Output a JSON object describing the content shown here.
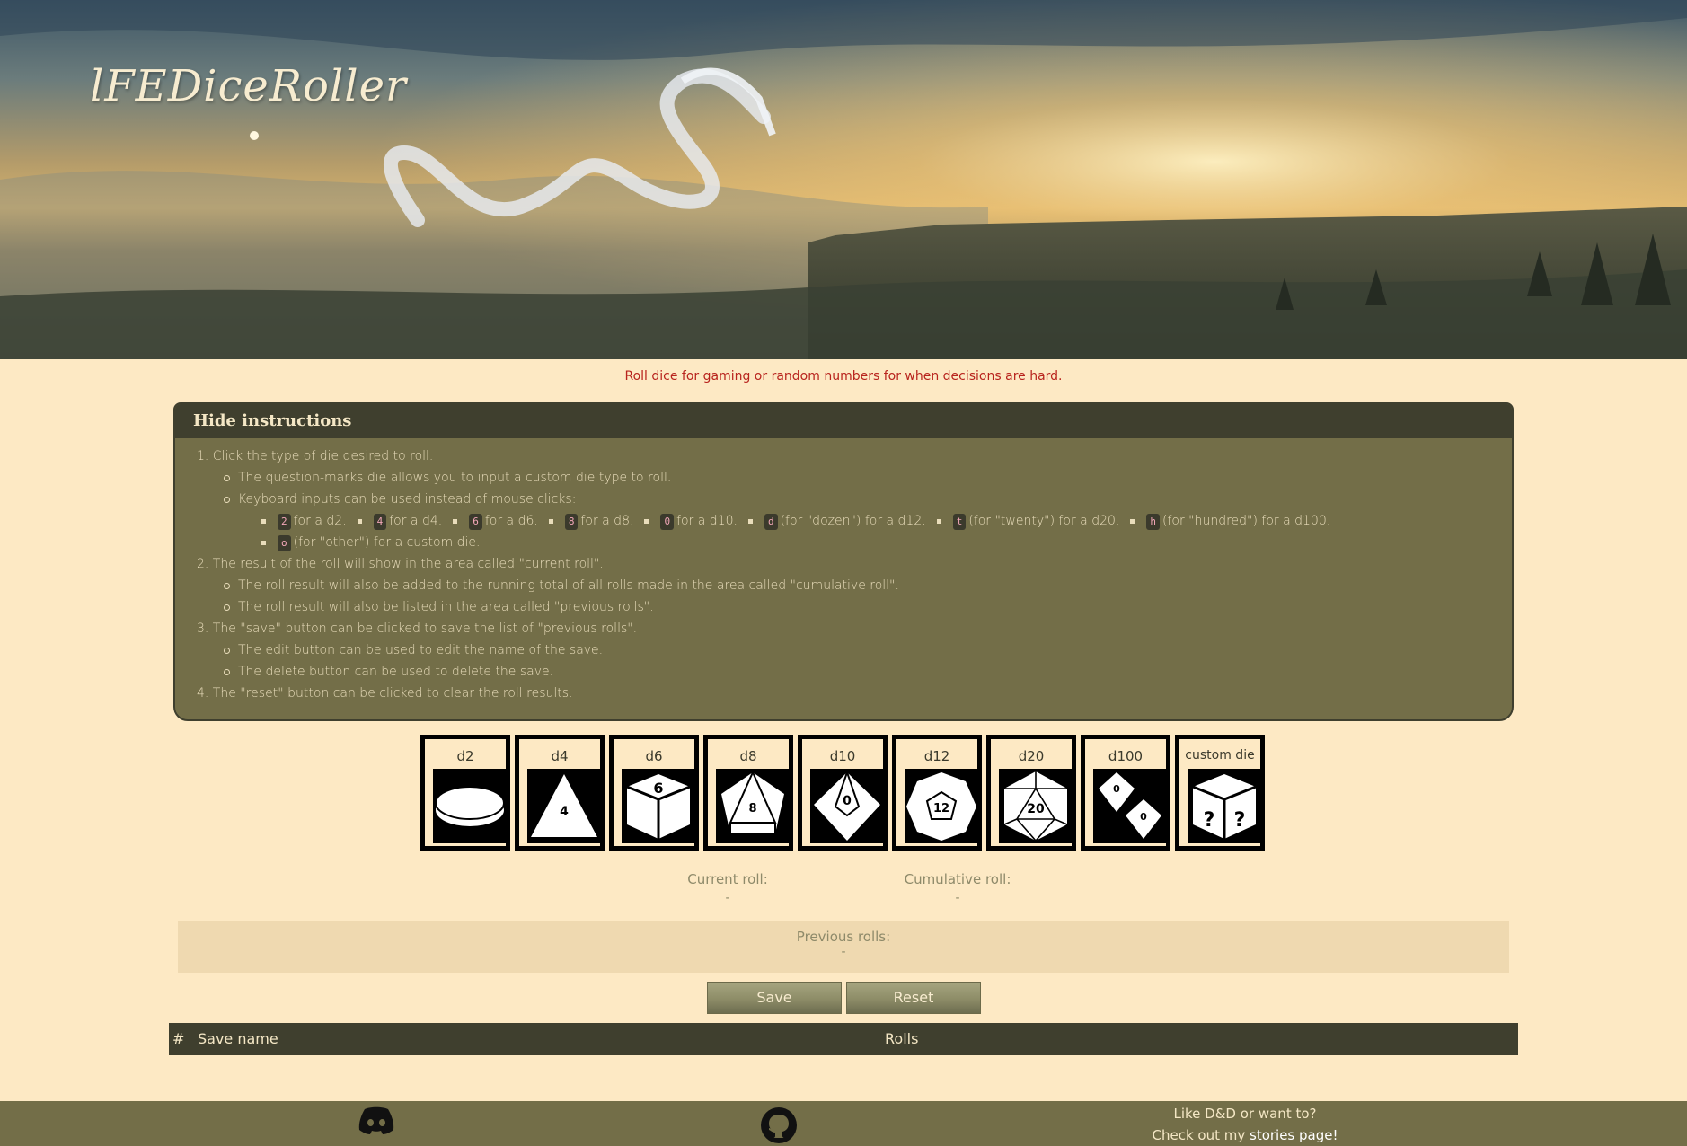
{
  "site": {
    "title": "lFEDiceRoller",
    "tagline": "Roll dice for gaming or random numbers for when decisions are hard."
  },
  "instructions": {
    "toggle_label": "Hide instructions",
    "step1": "1. Click the type of die desired to roll.",
    "step1_sub1": "The question-marks die allows you to input a custom die type to roll.",
    "step1_sub2": "Keyboard inputs can be used instead of mouse clicks:",
    "keys": [
      {
        "key": "2",
        "text": "for a d2."
      },
      {
        "key": "4",
        "text": "for a d4."
      },
      {
        "key": "6",
        "text": "for a d6."
      },
      {
        "key": "8",
        "text": "for a d8."
      },
      {
        "key": "0",
        "text": "for a d10."
      },
      {
        "key": "d",
        "text": "(for \"dozen\") for a d12."
      },
      {
        "key": "t",
        "text": "(for \"twenty\") for a d20."
      },
      {
        "key": "h",
        "text": "(for \"hundred\") for a d100."
      },
      {
        "key": "o",
        "text": "(for \"other\") for a custom die."
      }
    ],
    "step2": "2. The result of the roll will show in the area called \"current roll\".",
    "step2_sub1": "The roll result will also be added to the running total of all rolls made in the area called \"cumulative roll\".",
    "step2_sub2": "The roll result will also be listed in the area called \"previous rolls\".",
    "step3": "3. The \"save\" button can be clicked to save the list of \"previous rolls\".",
    "step3_sub1": "The edit button can be used to edit the name of the save.",
    "step3_sub2": "The delete button can be used to delete the save.",
    "step4": "4. The \"reset\" button can be clicked to clear the roll results."
  },
  "dice": [
    {
      "label": "d2",
      "icon": "coin-icon"
    },
    {
      "label": "d4",
      "icon": "d4-icon",
      "face": "4"
    },
    {
      "label": "d6",
      "icon": "d6-icon",
      "face": "6"
    },
    {
      "label": "d8",
      "icon": "d8-icon",
      "face": "8"
    },
    {
      "label": "d10",
      "icon": "d10-icon",
      "face": "0"
    },
    {
      "label": "d12",
      "icon": "d12-icon",
      "face": "12"
    },
    {
      "label": "d20",
      "icon": "d20-icon",
      "face": "20"
    },
    {
      "label": "d100",
      "icon": "d100-icon",
      "face": "0"
    },
    {
      "label": "custom die",
      "icon": "question-die-icon",
      "face": "?"
    }
  ],
  "results": {
    "current_label": "Current roll:",
    "current_value": "-",
    "cumulative_label": "Cumulative roll:",
    "cumulative_value": "-",
    "previous_label": "Previous rolls:",
    "previous_value": "-"
  },
  "buttons": {
    "save": "Save",
    "reset": "Reset"
  },
  "saves_table": {
    "col_index": "#",
    "col_name": "Save name",
    "col_rolls": "Rolls"
  },
  "footer": {
    "line1": "Like D&D or want to?",
    "line2_prefix": "Check out my ",
    "line2_link": "stories page!"
  },
  "colors": {
    "accent": "#736e48",
    "dark": "#3f3f2e",
    "background": "#fde9c4",
    "tagline": "#b8231d"
  }
}
